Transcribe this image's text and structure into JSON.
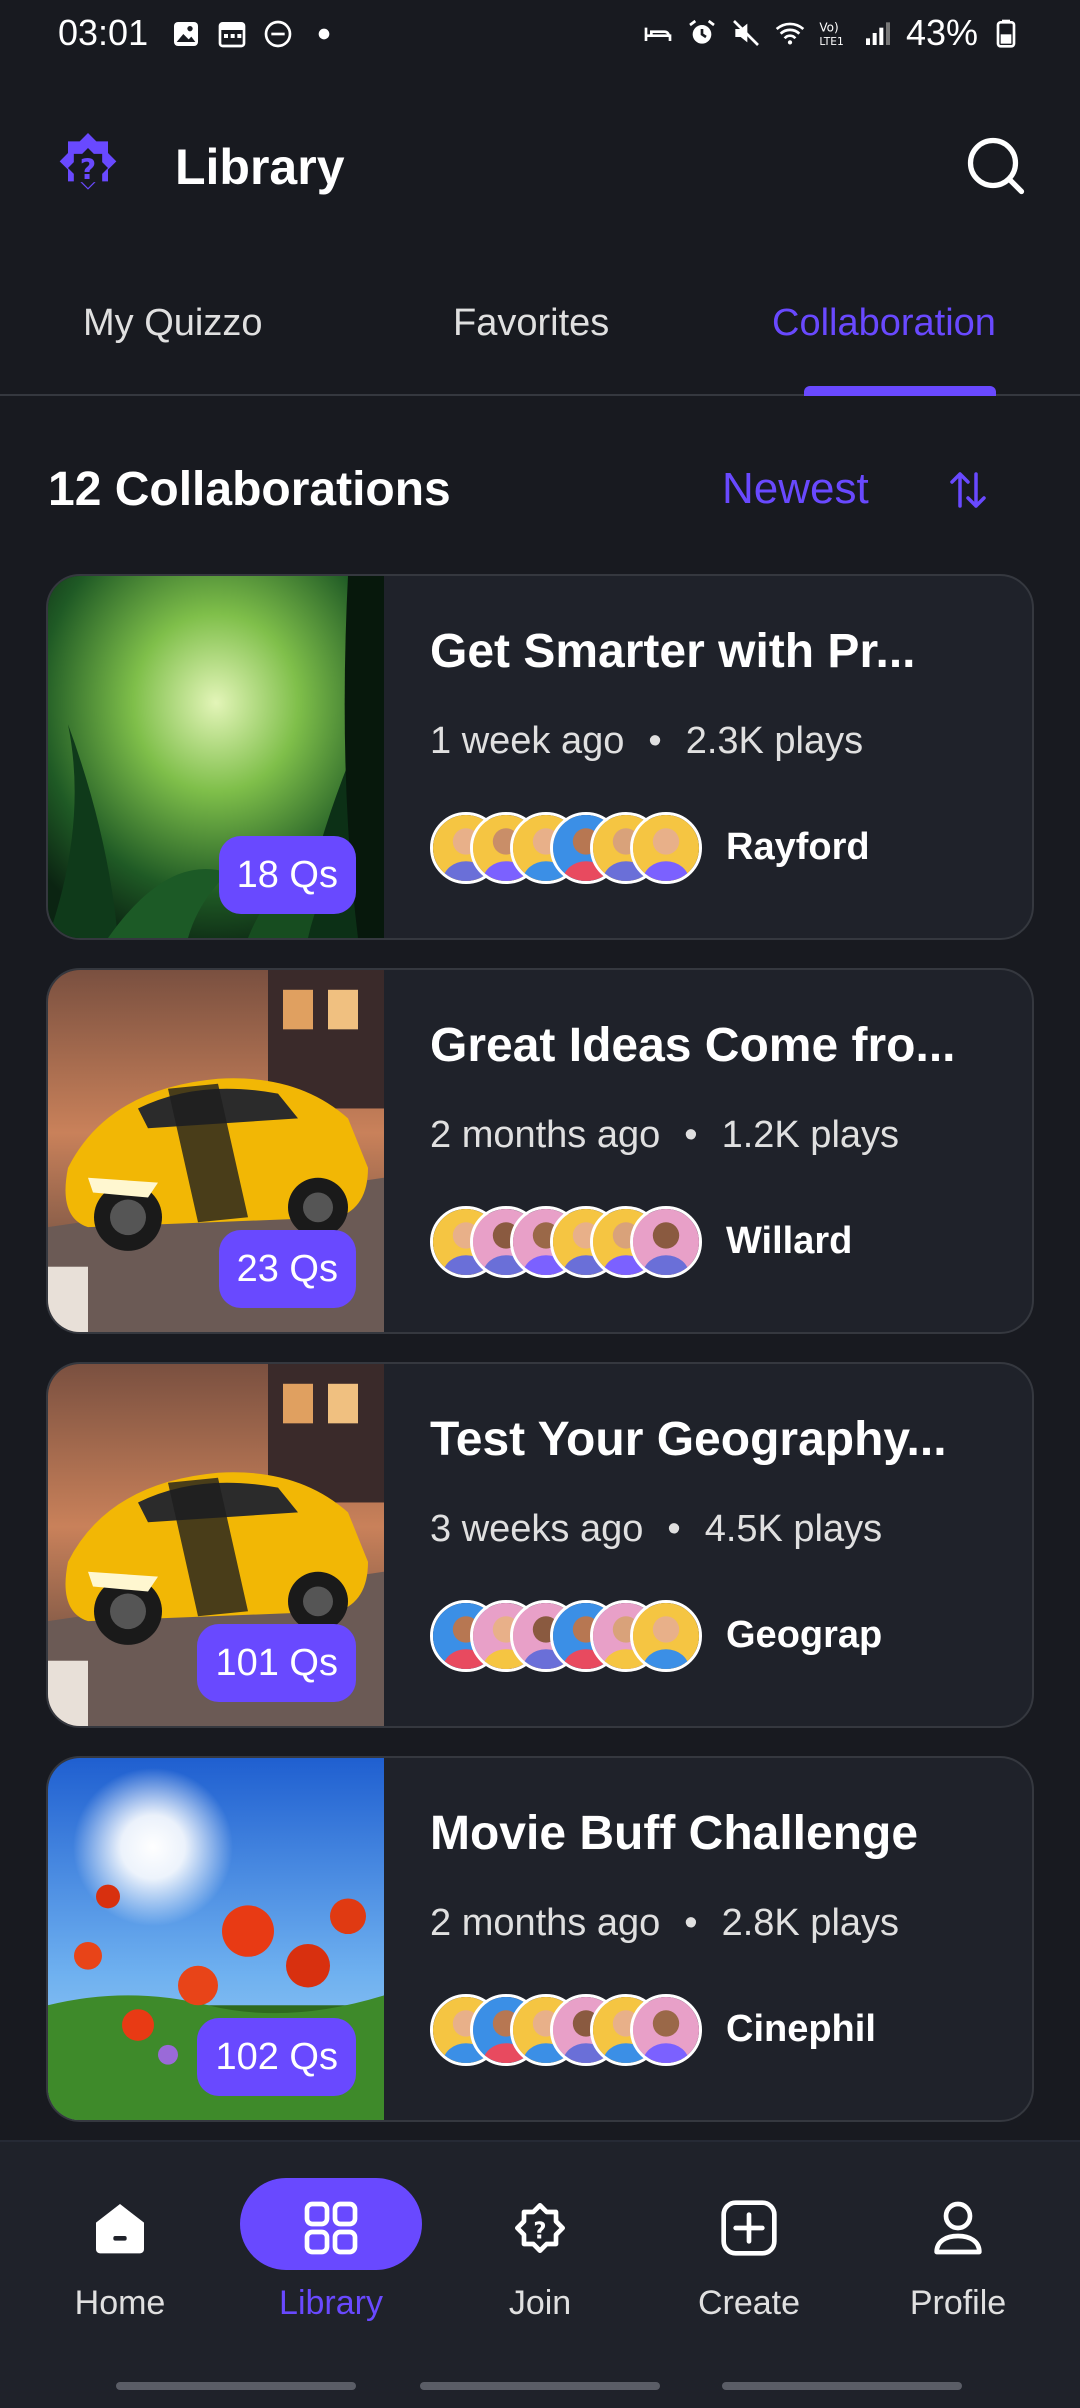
{
  "status_bar": {
    "time": "03:01",
    "battery": "43%",
    "icons_left": [
      "gallery-icon",
      "calendar-icon",
      "do-not-disturb-icon",
      "dot-icon"
    ],
    "icons_right": [
      "sleep-icon",
      "alarm-icon",
      "mute-icon",
      "wifi-icon",
      "volte-icon",
      "signal-icon",
      "battery-icon"
    ]
  },
  "header": {
    "title": "Library",
    "logo_icon": "quiz-logo-icon",
    "search_icon": "search-icon"
  },
  "tabs": [
    {
      "label": "My Quizzo",
      "active": false
    },
    {
      "label": "Favorites",
      "active": false
    },
    {
      "label": "Collaboration",
      "active": true
    }
  ],
  "section": {
    "title": "12 Collaborations",
    "sort_label": "Newest",
    "sort_icon": "sort-arrows-icon"
  },
  "cards": [
    {
      "title": "Get Smarter with Pr...",
      "time": "1 week ago",
      "plays": "2.3K plays",
      "questions": "18 Qs",
      "author": "Rayford",
      "thumb": "jungle"
    },
    {
      "title": "Great Ideas Come fro...",
      "time": "2 months ago",
      "plays": "1.2K plays",
      "questions": "23 Qs",
      "author": "Willard",
      "thumb": "car"
    },
    {
      "title": "Test Your Geography...",
      "time": "3 weeks ago",
      "plays": "4.5K plays",
      "questions": "101 Qs",
      "author": "Geograp",
      "thumb": "car"
    },
    {
      "title": "Movie Buff Challenge",
      "time": "2 months ago",
      "plays": "2.8K plays",
      "questions": "102 Qs",
      "author": "Cinephil",
      "thumb": "poppies"
    }
  ],
  "nav": [
    {
      "label": "Home",
      "icon": "home-icon",
      "active": false
    },
    {
      "label": "Library",
      "icon": "grid-icon",
      "active": true
    },
    {
      "label": "Join",
      "icon": "quiz-join-icon",
      "active": false
    },
    {
      "label": "Create",
      "icon": "plus-square-icon",
      "active": false
    },
    {
      "label": "Profile",
      "icon": "user-icon",
      "active": false
    }
  ],
  "colors": {
    "background": "#181a20",
    "card": "#1f222a",
    "accent": "#6949ff",
    "border": "#35383f"
  }
}
